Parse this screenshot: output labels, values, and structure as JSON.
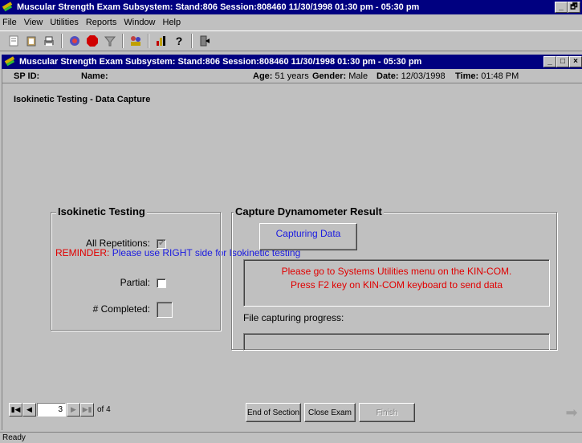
{
  "window": {
    "title": "Muscular Strength Exam Subsystem: Stand:806 Session:808460 11/30/1998 01:30 pm - 05:30 pm",
    "controls": [
      "_",
      "🗗",
      "×"
    ]
  },
  "menu": [
    "File",
    "View",
    "Utilities",
    "Reports",
    "Window",
    "Help"
  ],
  "toolbar": {
    "icons": [
      "notepad-icon",
      "clipboard-icon",
      "printer-icon",
      "hand-icon",
      "stop-icon",
      "filter-icon",
      "people-icon",
      "chart-icon",
      "help-icon",
      "exit-icon"
    ]
  },
  "child_window": {
    "title": "Muscular Strength Exam Subsystem: Stand:806 Session:808460 11/30/1998 01:30 pm - 05:30 pm"
  },
  "participant": {
    "sp_id_label": "SP ID:",
    "sp_id": "",
    "name_label": "Name:",
    "name": "",
    "age_label": "Age:",
    "age": "51 years",
    "gender_label": "Gender:",
    "gender": "Male",
    "date_label": "Date:",
    "date": "12/03/1998",
    "time_label": "Time:",
    "time": "01:48 PM"
  },
  "section_title": "Isokinetic Testing - Data Capture",
  "reminder": {
    "label": "REMINDER:",
    "message": "Please use RIGHT side for Isokinetic testing"
  },
  "isokinetic": {
    "title": "Isokinetic Testing",
    "all_repetitions_label": "All Repetitions:",
    "all_repetitions_checked": true,
    "partial_label": "Partial:",
    "partial_checked": false,
    "completed_label": "# Completed:",
    "completed_value": ""
  },
  "capture": {
    "title": "Capture Dynamometer Result",
    "button_label": "Capturing Data",
    "instructions_line1": "Please go to Systems Utilities menu on the KIN-COM.",
    "instructions_line2": "Press F2 key on KIN-COM keyboard to send data",
    "progress_label": "File capturing progress:",
    "progress_fraction": 0
  },
  "navigation": {
    "current_page": "3",
    "of_label": "of 4"
  },
  "buttons": {
    "end_of_section": "End of Section",
    "close_exam": "Close Exam",
    "finish": "Finish"
  },
  "status": "Ready"
}
